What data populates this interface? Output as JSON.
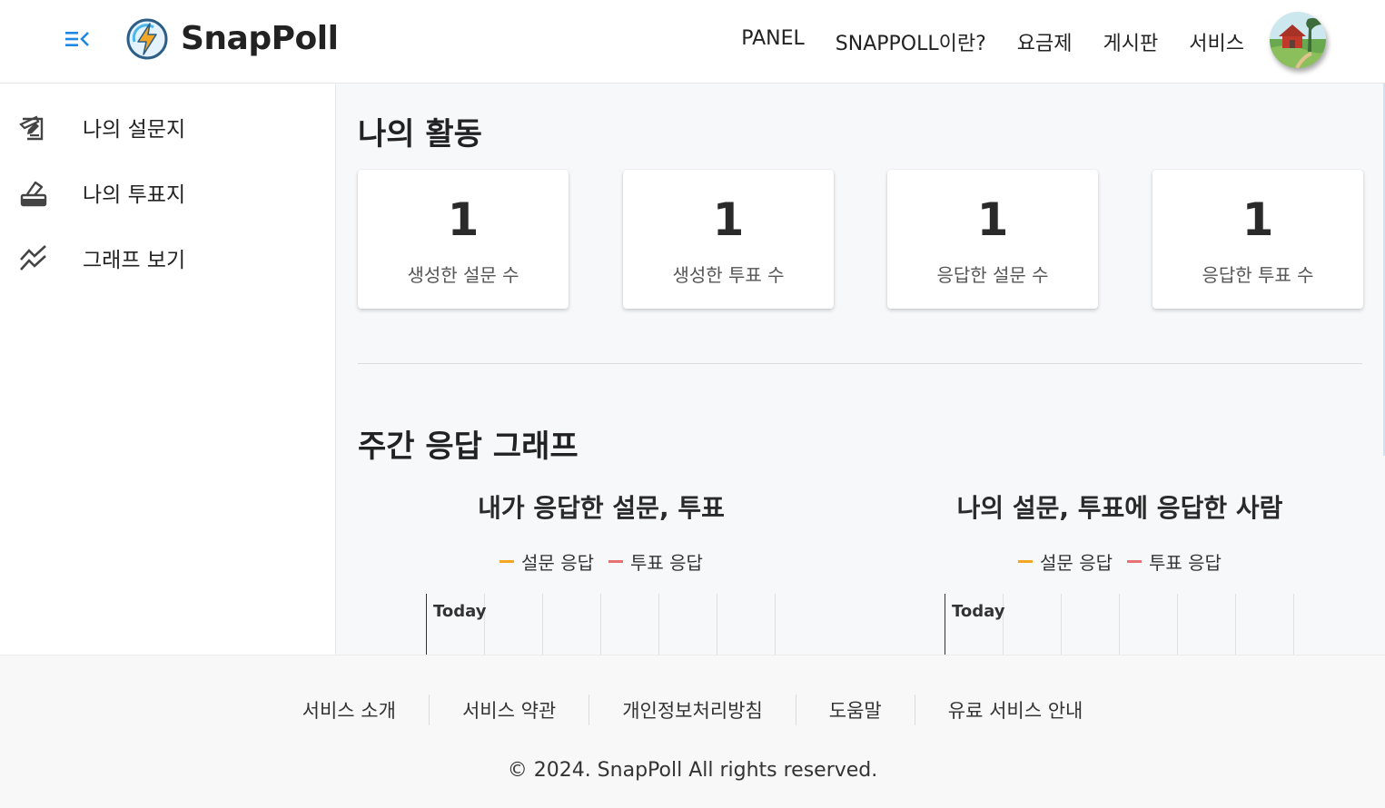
{
  "header": {
    "logo_text": "SnapPoll",
    "nav": [
      "PANEL",
      "SNAPPOLL이란?",
      "요금제",
      "게시판",
      "서비스"
    ],
    "accent_color": "#1e88e5"
  },
  "sidebar": {
    "items": [
      {
        "label": "나의 설문지",
        "icon": "survey-sign-icon"
      },
      {
        "label": "나의 투표지",
        "icon": "ballot-box-icon"
      },
      {
        "label": "그래프 보기",
        "icon": "chart-line-icon"
      }
    ]
  },
  "activity": {
    "title": "나의 활동",
    "cards": [
      {
        "value": "1",
        "label": "생성한 설문 수"
      },
      {
        "value": "1",
        "label": "생성한 투표 수"
      },
      {
        "value": "1",
        "label": "응답한 설문 수"
      },
      {
        "value": "1",
        "label": "응답한 투표 수"
      }
    ]
  },
  "weekly": {
    "title": "주간 응답 그래프",
    "charts": [
      {
        "title": "내가 응답한 설문, 투표",
        "legend": [
          "설문 응답",
          "투표 응답"
        ],
        "x_first_tick": "Today"
      },
      {
        "title": "나의 설문, 투표에 응답한 사람",
        "legend": [
          "설문 응답",
          "투표 응답"
        ],
        "x_first_tick": "Today"
      }
    ],
    "legend_colors": [
      "#f5a623",
      "#e57373"
    ]
  },
  "footer": {
    "links": [
      "서비스 소개",
      "서비스 약관",
      "개인정보처리방침",
      "도움말",
      "유료 서비스 안내"
    ],
    "copyright": "© 2024. SnapPoll All rights reserved."
  }
}
